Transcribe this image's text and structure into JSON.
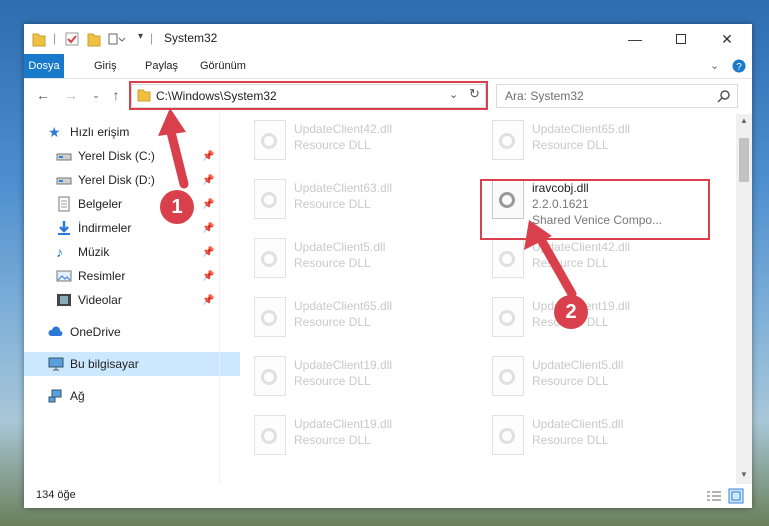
{
  "window": {
    "title": "System32"
  },
  "ribbon": {
    "tabs": [
      "Dosya",
      "Giriş",
      "Paylaş",
      "Görünüm"
    ]
  },
  "address": {
    "path": "C:\\Windows\\System32"
  },
  "search": {
    "placeholder": "Ara: System32"
  },
  "sidebar": {
    "items": [
      {
        "label": "Hızlı erişim",
        "icon": "star-icon"
      },
      {
        "label": "Yerel Disk (C:)",
        "icon": "drive-icon"
      },
      {
        "label": "Yerel Disk (D:)",
        "icon": "drive-icon"
      },
      {
        "label": "Belgeler",
        "icon": "document-icon"
      },
      {
        "label": "İndirmeler",
        "icon": "download-icon"
      },
      {
        "label": "Müzik",
        "icon": "music-icon"
      },
      {
        "label": "Resimler",
        "icon": "picture-icon"
      },
      {
        "label": "Videolar",
        "icon": "video-icon"
      },
      {
        "label": "OneDrive",
        "icon": "cloud-icon"
      },
      {
        "label": "Bu bilgisayar",
        "icon": "computer-icon"
      },
      {
        "label": "Ağ",
        "icon": "network-icon"
      }
    ]
  },
  "files": {
    "left": [
      {
        "name": "UpdateClient42.dll",
        "desc": "Resource DLL"
      },
      {
        "name": "UpdateClient63.dll",
        "desc": "Resource DLL"
      },
      {
        "name": "UpdateClient5.dll",
        "desc": "Resource DLL"
      },
      {
        "name": "UpdateClient65.dll",
        "desc": "Resource DLL"
      },
      {
        "name": "UpdateClient19.dll",
        "desc": "Resource DLL"
      },
      {
        "name": "UpdateClient19.dll",
        "desc": "Resource DLL"
      }
    ],
    "right": [
      {
        "name": "UpdateClient65.dll",
        "desc": "Resource DLL"
      },
      {
        "name": "UpdateClient42.dll",
        "desc": "Resource DLL"
      },
      {
        "name": "UpdateClient19.dll",
        "desc": "Resource DLL"
      },
      {
        "name": "UpdateClient5.dll",
        "desc": "Resource DLL"
      },
      {
        "name": "UpdateClient5.dll",
        "desc": "Resource DLL"
      }
    ],
    "highlighted": {
      "name": "iravcobj.dll",
      "version": "2.2.0.1621",
      "desc": "Shared Venice Compo..."
    }
  },
  "annotations": {
    "badge1": "1",
    "badge2": "2"
  },
  "status": {
    "count": "134 öğe"
  },
  "colors": {
    "accent": "#1979ca",
    "highlight": "#d9404c",
    "selected": "#cce8ff"
  }
}
